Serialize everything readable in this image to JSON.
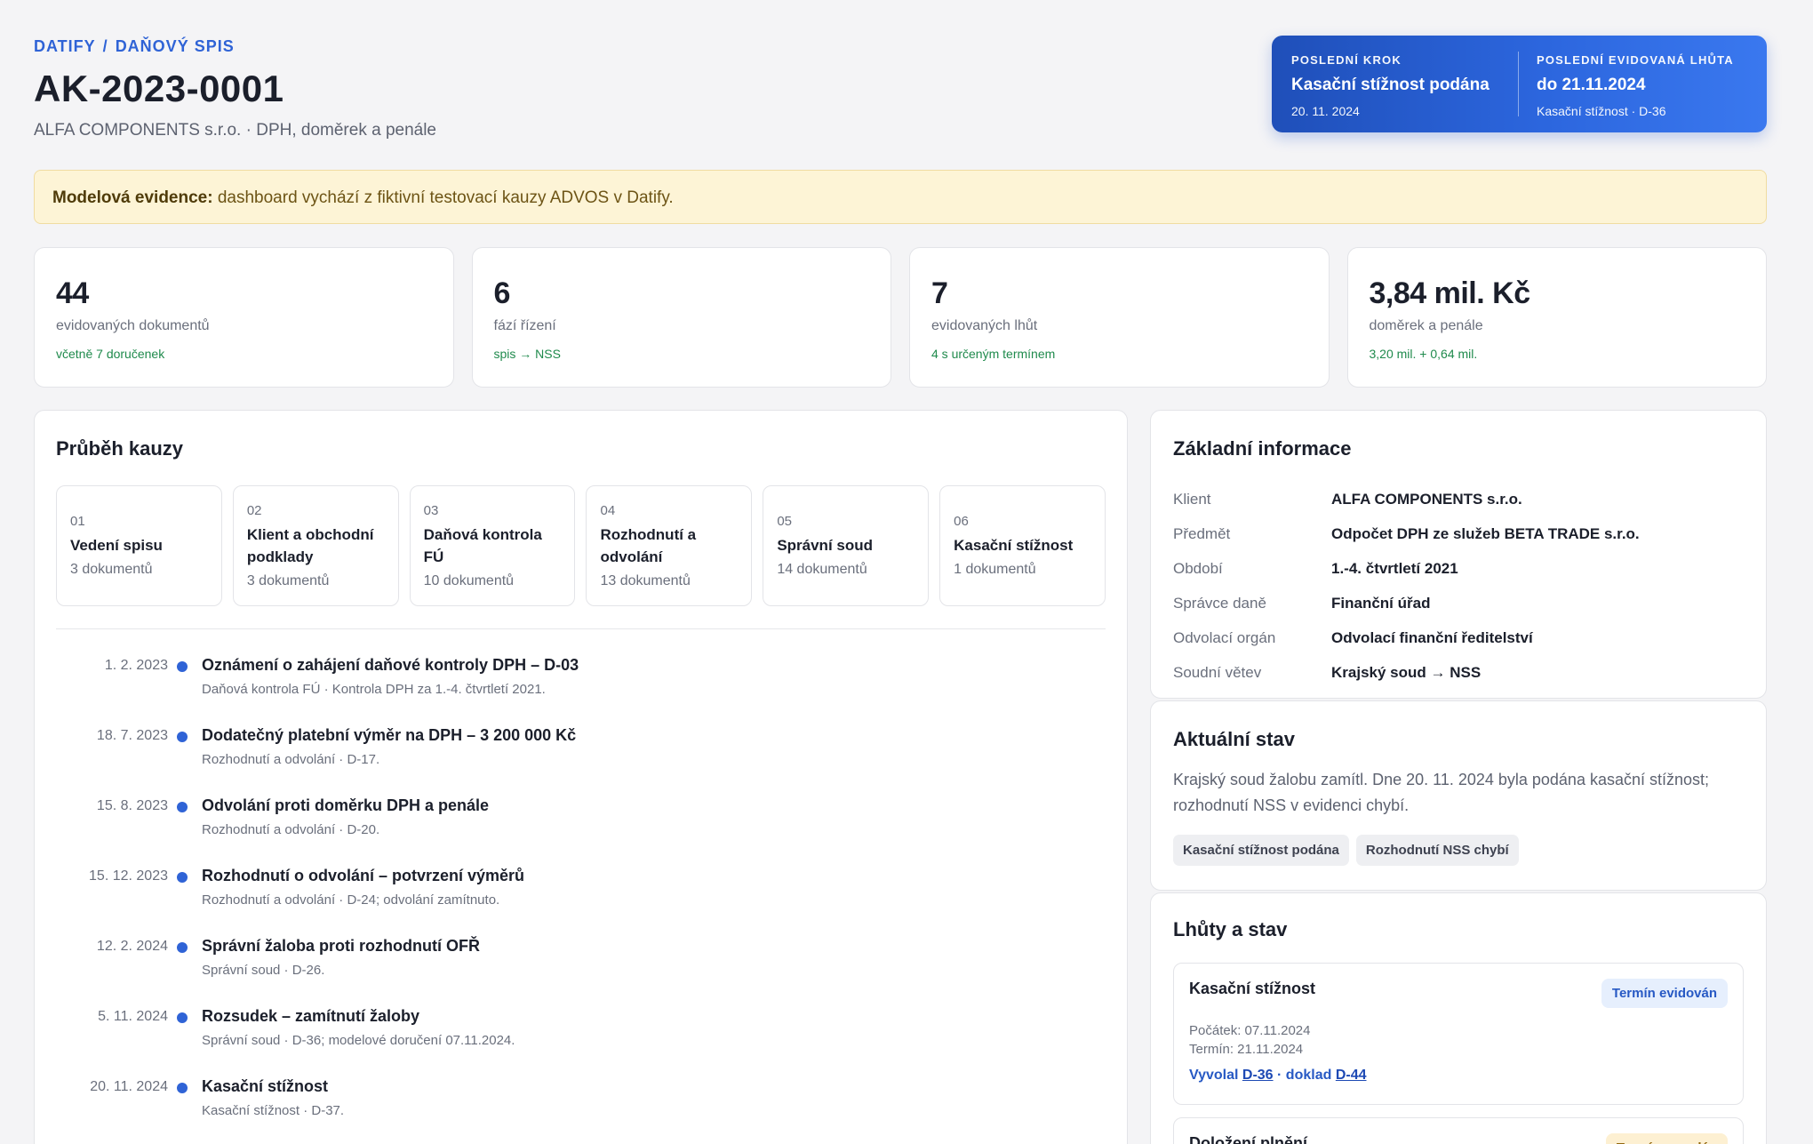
{
  "header": {
    "breadcrumb": [
      "DATIFY",
      "DAŇOVÝ SPIS"
    ],
    "title": "AK-2023-0001",
    "subtitle": "ALFA COMPONENTS s.r.o. · DPH, doměrek a penále"
  },
  "status": {
    "last_step_label": "POSLEDNÍ KROK",
    "last_step_value": "Kasační stížnost podána",
    "last_step_date": "20. 11. 2024",
    "deadline_label": "POSLEDNÍ EVIDOVANÁ LHŮTA",
    "deadline_value": "do 21.11.2024",
    "deadline_sub": "Kasační stížnost · D-36"
  },
  "notice": {
    "bold": "Modelová evidence:",
    "text": " dashboard vychází z fiktivní testovací kauzy ADVOS v Datify."
  },
  "stats": [
    {
      "num": "44",
      "label": "evidovaných dokumentů",
      "note": "včetně 7 doručenek"
    },
    {
      "num": "6",
      "label": "fází řízení",
      "note": "spis → NSS"
    },
    {
      "num": "7",
      "label": "evidovaných lhůt",
      "note": "4 s určeným termínem"
    },
    {
      "num": "3,84 mil. Kč",
      "label": "doměrek a penále",
      "note": "3,20 mil. + 0,64 mil."
    }
  ],
  "timeline": {
    "title": "Průběh kauzy",
    "phases": [
      {
        "no": "01",
        "name": "Vedení spisu",
        "count": "3 dokumentů"
      },
      {
        "no": "02",
        "name": "Klient a obchodní podklady",
        "count": "3 dokumentů"
      },
      {
        "no": "03",
        "name": "Daňová kontrola FÚ",
        "count": "10 dokumentů"
      },
      {
        "no": "04",
        "name": "Rozhodnutí a odvolání",
        "count": "13 dokumentů"
      },
      {
        "no": "05",
        "name": "Správní soud",
        "count": "14 dokumentů"
      },
      {
        "no": "06",
        "name": "Kasační stížnost",
        "count": "1 dokumentů"
      }
    ],
    "events": [
      {
        "date": "1. 2. 2023",
        "title": "Oznámení o zahájení daňové kontroly DPH – D-03",
        "desc": "Daňová kontrola FÚ · Kontrola DPH za 1.-4. čtvrtletí 2021."
      },
      {
        "date": "18. 7. 2023",
        "title": "Dodatečný platební výměr na DPH – 3 200 000 Kč",
        "desc": "Rozhodnutí a odvolání · D-17."
      },
      {
        "date": "15. 8. 2023",
        "title": "Odvolání proti doměrku DPH a penále",
        "desc": "Rozhodnutí a odvolání · D-20."
      },
      {
        "date": "15. 12. 2023",
        "title": "Rozhodnutí o odvolání – potvrzení výměrů",
        "desc": "Rozhodnutí a odvolání · D-24; odvolání zamítnuto."
      },
      {
        "date": "12. 2. 2024",
        "title": "Správní žaloba proti rozhodnutí OFŘ",
        "desc": "Správní soud · D-26."
      },
      {
        "date": "5. 11. 2024",
        "title": "Rozsudek – zamítnutí žaloby",
        "desc": "Správní soud · D-36; modelové doručení 07.11.2024."
      },
      {
        "date": "20. 11. 2024",
        "title": "Kasační stížnost",
        "desc": "Kasační stížnost · D-37."
      }
    ]
  },
  "info": {
    "title": "Základní informace",
    "rows": [
      {
        "k": "Klient",
        "v": "ALFA COMPONENTS s.r.o."
      },
      {
        "k": "Předmět",
        "v": "Odpočet DPH ze služeb BETA TRADE s.r.o."
      },
      {
        "k": "Období",
        "v": "1.-4. čtvrtletí 2021"
      },
      {
        "k": "Správce daně",
        "v": "Finanční úřad"
      },
      {
        "k": "Odvolací orgán",
        "v": "Odvolací finanční ředitelství"
      },
      {
        "k": "Soudní větev",
        "v": "Krajský soud → NSS"
      }
    ]
  },
  "state": {
    "title": "Aktuální stav",
    "text": "Krajský soud žalobu zamítl. Dne 20. 11. 2024 byla podána kasační stížnost; rozhodnutí NSS v evidenci chybí.",
    "chips": [
      "Kasační stížnost podána",
      "Rozhodnutí NSS chybí"
    ]
  },
  "deadlines": {
    "title": "Lhůty a stav",
    "card1": {
      "name": "Kasační stížnost",
      "badge": "Termín evidován",
      "start": "Počátek: 07.11.2024",
      "end": "Termín: 21.11.2024",
      "links_prefix": "Vyvolal ",
      "link1": "D-36",
      "links_mid": " · doklad ",
      "link2": "D-44"
    },
    "card2": {
      "name": "Doložení plnění",
      "badge": "Termín nezadán"
    }
  },
  "colors": {
    "accent": "#2f63d6",
    "success": "#1f8a4c",
    "notice_bg": "#fdf4d6"
  }
}
